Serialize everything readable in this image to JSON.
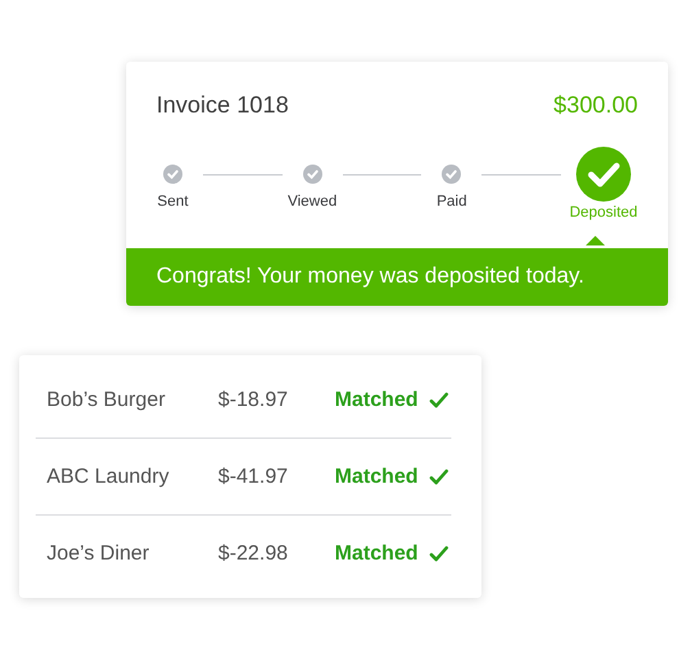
{
  "invoice": {
    "title": "Invoice 1018",
    "amount": "$300.00",
    "steps": [
      {
        "label": "Sent",
        "selected": false
      },
      {
        "label": "Viewed",
        "selected": false
      },
      {
        "label": "Paid",
        "selected": false
      },
      {
        "label": "Deposited",
        "selected": true
      }
    ],
    "banner": "Congrats! Your money was deposited today."
  },
  "transactions": [
    {
      "name": "Bob’s Burger",
      "amount": "$-18.97",
      "status": "Matched",
      "matched": true
    },
    {
      "name": "ABC Laundry",
      "amount": "$-41.97",
      "status": "Matched",
      "matched": true
    },
    {
      "name": "Joe’s Diner",
      "amount": "$-22.98",
      "status": "Matched",
      "matched": true
    }
  ]
}
